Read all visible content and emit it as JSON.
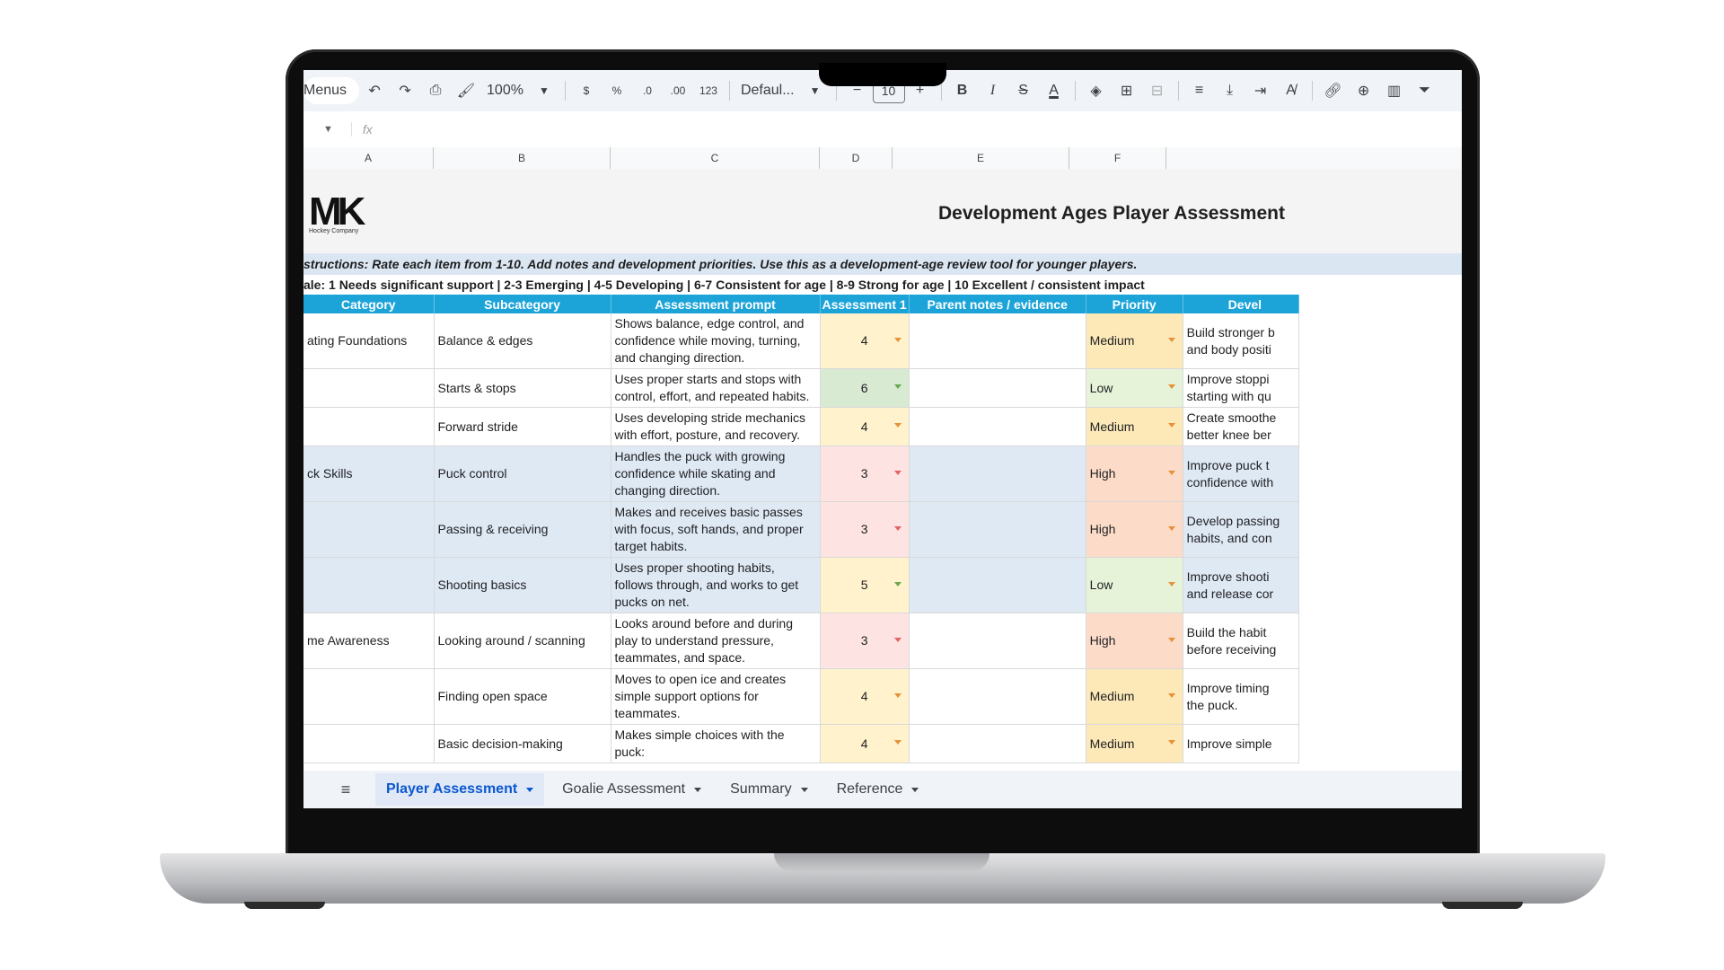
{
  "toolbar": {
    "menus_label": "Menus",
    "zoom": "100%",
    "currency": "$",
    "percent": "%",
    "dec_less": ".0",
    "dec_more": ".00",
    "number_format": "123",
    "font": "Defaul...",
    "font_size": "10",
    "bold": "B",
    "italic": "I",
    "strike": "S",
    "text_color": "A"
  },
  "formula_bar": {
    "fx": "fx"
  },
  "columns": [
    "A",
    "B",
    "C",
    "D",
    "E",
    "F"
  ],
  "sheet": {
    "logo_text": "MK",
    "logo_sub": "Hockey Company",
    "title": "Development Ages Player Assessment",
    "instructions": "structions: Rate each item from 1-10. Add notes and development priorities. Use this as a development-age review tool for younger players.",
    "scale": "ale: 1 Needs significant support | 2-3 Emerging | 4-5 Developing | 6-7 Consistent for age | 8-9 Strong for age | 10 Excellent / consistent impact",
    "headers": {
      "category": "Category",
      "subcategory": "Subcategory",
      "prompt": "Assessment prompt",
      "assessment": "Assessment 1",
      "notes": "Parent notes / evidence",
      "priority": "Priority",
      "dev": "Devel"
    },
    "rows": [
      {
        "category": "ating Foundations",
        "subcategory": "Balance & edges",
        "prompt": "Shows balance, edge control, and confidence while moving, turning, and changing direction.",
        "score": "4",
        "priority": "Medium",
        "dev1": "Build stronger b",
        "dev2": "and body positi"
      },
      {
        "category": "",
        "subcategory": "Starts & stops",
        "prompt": "Uses proper starts and stops with control, effort, and repeated habits.",
        "score": "6",
        "priority": "Low",
        "dev1": "Improve stoppi",
        "dev2": "starting with qu"
      },
      {
        "category": "",
        "subcategory": "Forward stride",
        "prompt": "Uses developing stride mechanics with effort, posture, and recovery.",
        "score": "4",
        "priority": "Medium",
        "dev1": "Create smoothe",
        "dev2": "better knee ber"
      },
      {
        "category": "ck Skills",
        "subcategory": "Puck control",
        "prompt": "Handles the puck with growing confidence while skating and changing direction.",
        "score": "3",
        "priority": "High",
        "dev1": "Improve puck t",
        "dev2": "confidence with"
      },
      {
        "category": "",
        "subcategory": "Passing & receiving",
        "prompt": "Makes and receives basic passes with focus, soft hands, and proper target habits.",
        "score": "3",
        "priority": "High",
        "dev1": "Develop passing",
        "dev2": "habits, and con"
      },
      {
        "category": "",
        "subcategory": "Shooting basics",
        "prompt": "Uses proper shooting habits, follows through, and works to get pucks on net.",
        "score": "5",
        "priority": "Low",
        "dev1": "Improve shooti",
        "dev2": "and release cor"
      },
      {
        "category": "me Awareness",
        "subcategory": "Looking around / scanning",
        "prompt": "Looks around before and during play to understand pressure, teammates, and space.",
        "score": "3",
        "priority": "High",
        "dev1": "Build the habit",
        "dev2": "before receiving"
      },
      {
        "category": "",
        "subcategory": "Finding open space",
        "prompt": "Moves to open ice and creates simple support options for teammates.",
        "score": "4",
        "priority": "Medium",
        "dev1": "Improve timing",
        "dev2": "the puck."
      },
      {
        "category": "",
        "subcategory": "Basic decision-making",
        "prompt": "Makes simple choices with the puck:",
        "score": "4",
        "priority": "Medium",
        "dev1": "Improve simple",
        "dev2": ""
      }
    ]
  },
  "tabs": [
    {
      "label": "Player Assessment",
      "active": true
    },
    {
      "label": "Goalie Assessment",
      "active": false
    },
    {
      "label": "Summary",
      "active": false
    },
    {
      "label": "Reference",
      "active": false
    }
  ],
  "colors": {
    "header_blue": "#1ca4d9",
    "medium": "#fff2cc",
    "low": "#d9ead3",
    "high": "#fde4e2",
    "active_tab": "#0b57d0"
  }
}
